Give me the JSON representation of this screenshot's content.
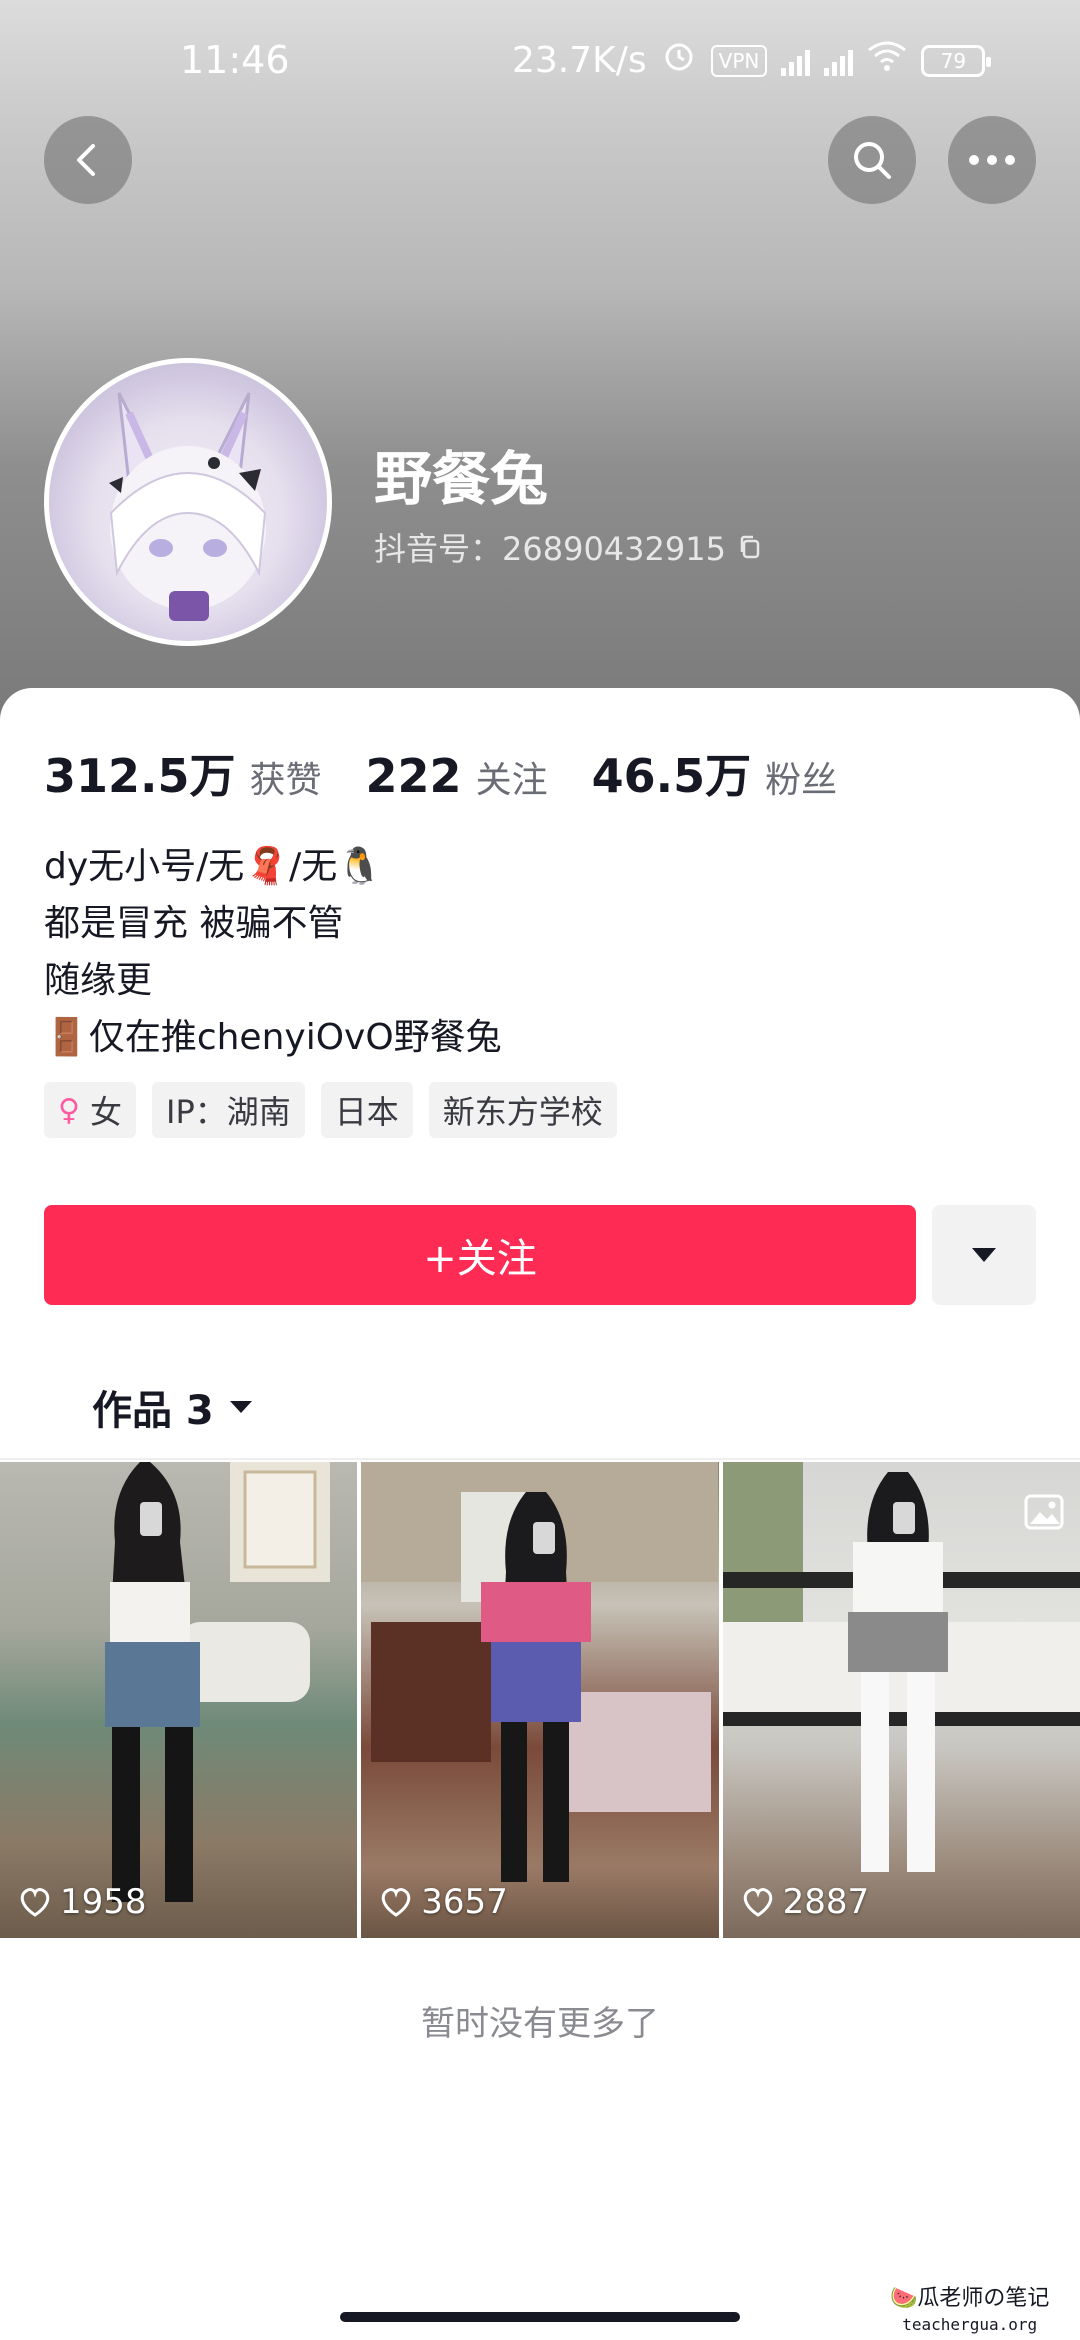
{
  "status_bar": {
    "time": "11:46",
    "network_speed": "23.7K/s",
    "vpn": "VPN",
    "battery": "79"
  },
  "header": {
    "back_icon": "chevron-left-icon",
    "search_icon": "search-icon",
    "more_icon": "more-icon"
  },
  "profile": {
    "username": "野餐兔",
    "douyin_id": "抖音号：26890432915"
  },
  "stats": [
    {
      "value": "312.5万",
      "label": "获赞"
    },
    {
      "value": "222",
      "label": "关注"
    },
    {
      "value": "46.5万",
      "label": "粉丝"
    }
  ],
  "bio": [
    "dy无小号/无🧣/无🐧",
    "都是冒充 被骗不管",
    "随缘更",
    "🚪仅在推chenyiOvO野餐兔"
  ],
  "tags": [
    {
      "text": "女",
      "icon": "female-icon"
    },
    {
      "text": "IP：湖南"
    },
    {
      "text": "日本"
    },
    {
      "text": "新东方学校"
    }
  ],
  "actions": {
    "follow_label": "+关注"
  },
  "works": {
    "tab_label": "作品 3"
  },
  "videos": [
    {
      "likes": "1958"
    },
    {
      "likes": "3657"
    },
    {
      "likes": "2887"
    }
  ],
  "footer": {
    "no_more": "暂时没有更多了"
  },
  "watermark": {
    "title": "🍉瓜老师の笔记",
    "url": "teachergua.org"
  }
}
